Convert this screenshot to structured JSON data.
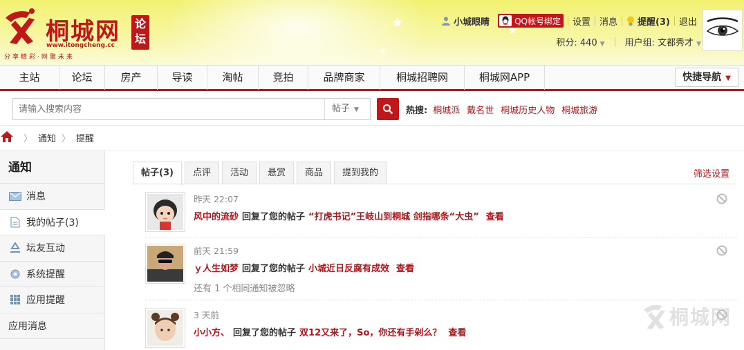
{
  "header": {
    "site_name": "桐城网",
    "forum_badge": "论坛",
    "url": "www.itongcheng.cc",
    "slogan": "分享精彩·网聚未来",
    "username": "小城眼睛",
    "qq_bind": "QQ帐号绑定",
    "settings": "设置",
    "messages": "消息",
    "remind": "提醒(3)",
    "logout": "退出",
    "points": "积分: 440",
    "usergroup": "用户组: 文都秀才"
  },
  "nav": {
    "items": [
      "主站",
      "论坛",
      "房产",
      "导读",
      "淘帖",
      "竞拍",
      "品牌商家",
      "桐城招聘网",
      "桐城网APP"
    ],
    "quick_nav": "快捷导航"
  },
  "search": {
    "placeholder": "请输入搜索内容",
    "scope": "帖子",
    "hot_label": "热搜:",
    "hot_keywords": [
      "桐城派",
      "戴名世",
      "桐城历史人物",
      "桐城旅游"
    ]
  },
  "breadcrumb": [
    "通知",
    "提醒"
  ],
  "sidebar": {
    "title": "通知",
    "items": [
      {
        "label": "消息",
        "icon": "envelope-icon"
      },
      {
        "label": "我的帖子(3)",
        "icon": "document-icon"
      },
      {
        "label": "坛友互动",
        "icon": "recycle-icon"
      },
      {
        "label": "系统提醒",
        "icon": "gear-icon"
      },
      {
        "label": "应用提醒",
        "icon": "grid-icon"
      },
      {
        "label": "应用消息",
        "icon": ""
      }
    ]
  },
  "tabs": [
    "帖子(3)",
    "点评",
    "活动",
    "悬赏",
    "商品",
    "提到我的"
  ],
  "filter": "筛选设置",
  "notices": [
    {
      "time": "昨天 22:07",
      "user": "风中的流砂",
      "action": "回复了您的帖子",
      "subject": "“打虎书记”王岐山到桐城 剑指哪条“大虫”",
      "view": "查看",
      "extra": ""
    },
    {
      "time": "前天 21:59",
      "user": "ｙ人生如梦",
      "action": "回复了您的帖子",
      "subject": "小城近日反腐有成效",
      "view": "查看",
      "extra": "还有 1 个相同通知被忽略"
    },
    {
      "time": "3 天前",
      "user": "小小方、",
      "action": "回复了您的帖子",
      "subject": "双12又来了，So，你还有手剁么？",
      "view": "查看",
      "extra": ""
    }
  ],
  "watermark": "桐城网",
  "colors": {
    "brand_red": "#c0171b",
    "link_red": "#b4141a",
    "header_yellow": "#f2f170"
  }
}
